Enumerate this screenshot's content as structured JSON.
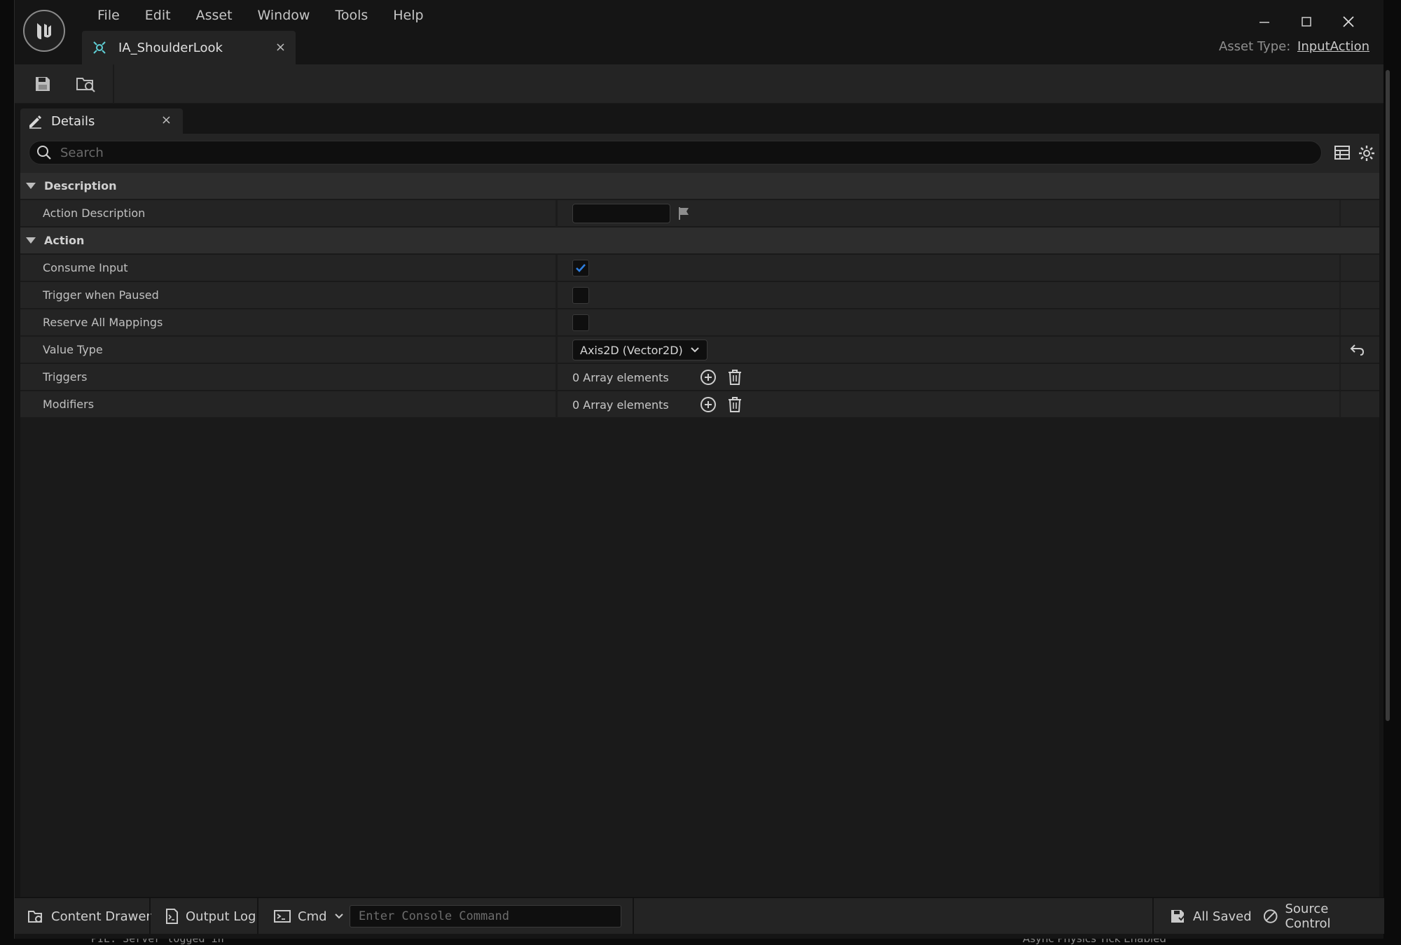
{
  "window": {
    "menus": [
      "File",
      "Edit",
      "Asset",
      "Window",
      "Tools",
      "Help"
    ],
    "tab_title": "IA_ShoulderLook",
    "tab_close": "×",
    "asset_type_label": "Asset Type:",
    "asset_type_value": "InputAction"
  },
  "details": {
    "tab_label": "Details",
    "tab_close": "×",
    "search_placeholder": "Search",
    "categories": {
      "description": "Description",
      "action": "Action"
    },
    "rows": {
      "action_description": {
        "label": "Action Description",
        "value": ""
      },
      "consume_input": {
        "label": "Consume Input",
        "checked": true
      },
      "trigger_when_paused": {
        "label": "Trigger when Paused",
        "checked": false
      },
      "reserve_all_mappings": {
        "label": "Reserve All Mappings",
        "checked": false
      },
      "value_type": {
        "label": "Value Type",
        "value": "Axis2D (Vector2D)"
      },
      "triggers": {
        "label": "Triggers",
        "value": "0 Array elements"
      },
      "modifiers": {
        "label": "Modifiers",
        "value": "0 Array elements"
      }
    }
  },
  "statusbar": {
    "content_drawer": "Content Drawer",
    "output_log": "Output Log",
    "cmd": "Cmd",
    "console_placeholder": "Enter Console Command",
    "all_saved": "All Saved",
    "source_control": "Source Control"
  },
  "background": {
    "bottom_left": "PIE: Server logged in",
    "bottom_right": "Async Physics Tick Enabled"
  },
  "colors": {
    "accent_blue": "#2f7fe0",
    "tab_icon_teal": "#5fd0d6",
    "panel": "#242424"
  }
}
